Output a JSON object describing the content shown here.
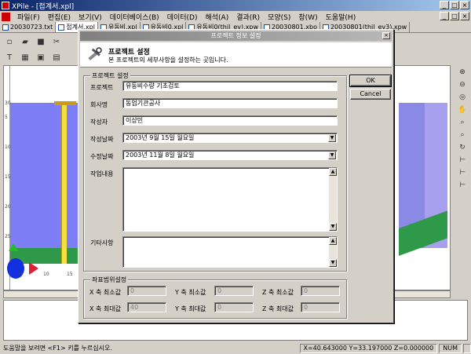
{
  "window": {
    "title": "XPile - [접계서.xpl]",
    "controls": [
      "_",
      "□",
      "×"
    ]
  },
  "menu": {
    "items": [
      "파일(F)",
      "편집(E)",
      "보기(V)",
      "데이터베이스(B)",
      "데이터(D)",
      "해석(A)",
      "결과(R)",
      "모양(S)",
      "창(W)",
      "도움말(H)"
    ],
    "mdi_controls": [
      "_",
      "□",
      "×"
    ]
  },
  "doc_tabs": [
    "20030723.txt",
    "접계서.xpl",
    "유동비.xpl",
    "유동비0.xpl",
    "유동비0(thil_ev).xpw",
    "20030801.xbo",
    "20030801(thil_ev3).xpw"
  ],
  "viewport": {
    "axis_x": [
      "5",
      "10",
      "15"
    ],
    "axis_y": [
      "5",
      "10",
      "15",
      "20",
      "25",
      "30"
    ]
  },
  "dialog": {
    "title": "프로젝트 정보 설정",
    "header_title": "프로젝트 설정",
    "header_desc": "본 프로젝트의 세부사항을 설정하는 곳입니다.",
    "group_project": "프로젝트 설정",
    "fields": {
      "project_label": "프로젝트",
      "project_value": "유동비수량 기초검토",
      "company_label": "회사명",
      "company_value": "동업기관공사",
      "author_label": "작성자",
      "author_value": "이상민",
      "created_label": "작성날짜",
      "created_value": "2003년   9월  15일 월요일",
      "modified_label": "수정날짜",
      "modified_value": "2003년 11월   8일 월요일",
      "content_label": "작업내용",
      "content_value": "",
      "notes_label": "기타사항",
      "notes_value": ""
    },
    "ok_label": "OK",
    "cancel_label": "Cancel",
    "group_coords": "좌표범위설정",
    "coords": {
      "x_min_label": "X 축 최소값",
      "x_min_value": "0",
      "y_min_label": "Y 축 최소값",
      "y_min_value": "0",
      "z_min_label": "Z 축 최소값",
      "z_min_value": "0",
      "x_max_label": "X 축 최대값",
      "x_max_value": "40",
      "y_max_label": "Y 축 최대값",
      "y_max_value": "0",
      "z_max_label": "Z 축 최대값",
      "z_max_value": "0"
    }
  },
  "status": {
    "message": "도움말을 보려면 <F1> 키를 누르십시오.",
    "coords": "X=40.643000  Y=33.197000  Z=0.000000",
    "num": "NUM"
  },
  "colors": {
    "title_start": "#0a246a",
    "title_end": "#a6caf0",
    "soil_blue": "#7d7df5",
    "soil_green": "#2e9a49",
    "pile_yellow": "#f4e042"
  }
}
